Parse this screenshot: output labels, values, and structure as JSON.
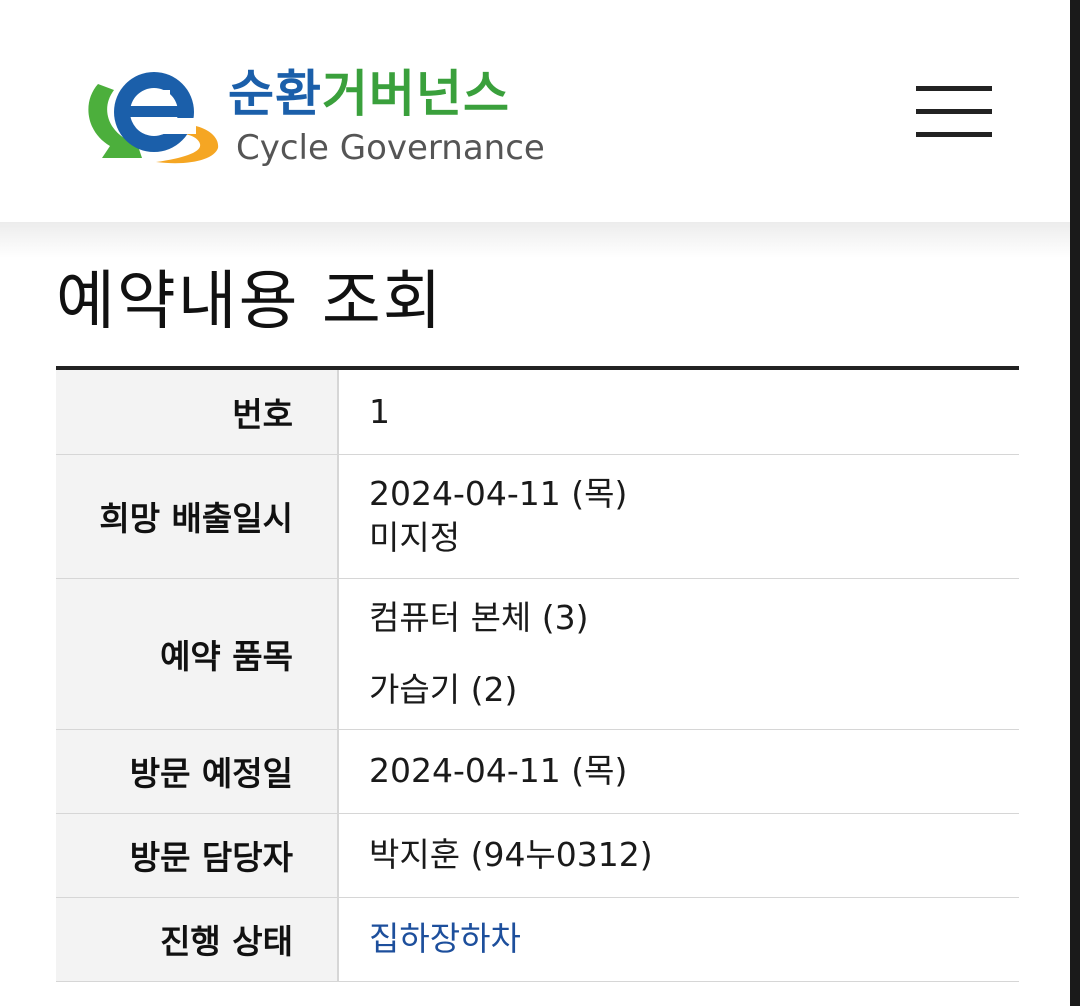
{
  "header": {
    "logo": {
      "ko_part1": "순환",
      "ko_part2": "거버넌스",
      "en": "Cycle Governance",
      "colors": {
        "blue": "#1b5faa",
        "green": "#3aa03c",
        "orange": "#f5a623"
      }
    },
    "menu_icon": "hamburger-menu-icon"
  },
  "page": {
    "title": "예약내용 조회"
  },
  "details": {
    "number": {
      "label": "번호",
      "value": "1"
    },
    "desired_date": {
      "label": "희망 배출일시",
      "date": "2024-04-11 (목)",
      "time": "미지정"
    },
    "items": {
      "label": "예약 품목",
      "list": [
        "컴퓨터 본체 (3)",
        "가습기 (2)"
      ]
    },
    "visit_date": {
      "label": "방문 예정일",
      "value": "2024-04-11 (목)"
    },
    "visit_manager": {
      "label": "방문 담당자",
      "value": "박지훈 (94누0312)"
    },
    "status": {
      "label": "진행 상태",
      "value": "집하장하차",
      "color": "#1d4f9c"
    }
  }
}
